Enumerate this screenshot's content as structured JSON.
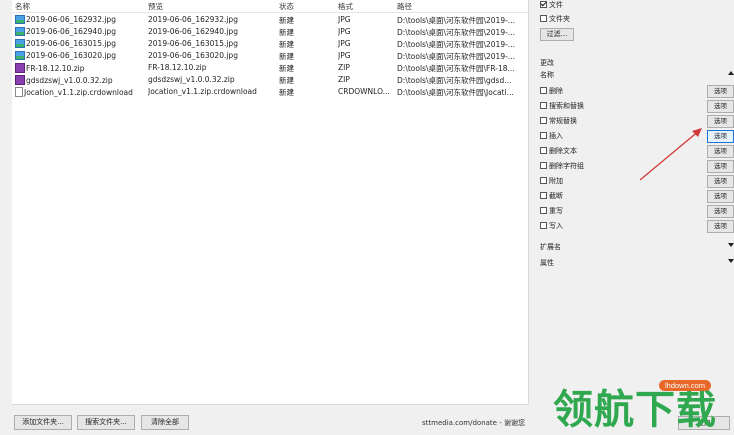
{
  "columns": [
    "名称",
    "预览",
    "状态",
    "格式",
    "路径"
  ],
  "rows": [
    {
      "name": "2019-06-06_162932.jpg",
      "preview": "2019-06-06_162932.jpg",
      "status": "新建",
      "format": "JPG",
      "path": "D:\\tools\\桌面\\河东软件园\\2019-...",
      "icon": "image-file-icon"
    },
    {
      "name": "2019-06-06_162940.jpg",
      "preview": "2019-06-06_162940.jpg",
      "status": "新建",
      "format": "JPG",
      "path": "D:\\tools\\桌面\\河东软件园\\2019-...",
      "icon": "image-file-icon"
    },
    {
      "name": "2019-06-06_163015.jpg",
      "preview": "2019-06-06_163015.jpg",
      "status": "新建",
      "format": "JPG",
      "path": "D:\\tools\\桌面\\河东软件园\\2019-...",
      "icon": "image-file-icon"
    },
    {
      "name": "2019-06-06_163020.jpg",
      "preview": "2019-06-06_163020.jpg",
      "status": "新建",
      "format": "JPG",
      "path": "D:\\tools\\桌面\\河东软件园\\2019-...",
      "icon": "image-file-icon"
    },
    {
      "name": "FR-18.12.10.zip",
      "preview": "FR-18.12.10.zip",
      "status": "新建",
      "format": "ZIP",
      "path": "D:\\tools\\桌面\\河东软件园\\FR-18...",
      "icon": "zip-file-icon"
    },
    {
      "name": "gdsdzswj_v1.0.0.32.zip",
      "preview": "gdsdzswj_v1.0.0.32.zip",
      "status": "新建",
      "format": "ZIP",
      "path": "D:\\tools\\桌面\\河东软件园\\gdsd...",
      "icon": "zip-file-icon"
    },
    {
      "name": "Jocation_v1.1.zip.crdownload",
      "preview": "Jocation_v1.1.zip.crdownload",
      "status": "新建",
      "format": "CRDOWNLO...",
      "path": "D:\\tools\\桌面\\河东软件园\\Jocati...",
      "icon": "download-file-icon"
    }
  ],
  "bottom": {
    "add_folder": "添加文件夹...",
    "search_folder": "搜索文件夹...",
    "clear_all": "清除全部",
    "status": "sttmedia.com/donate - 谢谢您"
  },
  "filter": {
    "file_label": "文件",
    "folder_label": "文件夹",
    "filter_button": "过滤..."
  },
  "changes": {
    "section": "更改",
    "name_label": "名称",
    "option_button": "选项",
    "items": [
      "删除",
      "搜索和替换",
      "常规替换",
      "插入",
      "删除文本",
      "删除字符组",
      "附加",
      "截断",
      "重写",
      "写入"
    ]
  },
  "extension_label": "扩展名",
  "attributes_label": "属性",
  "bottom_right_button": "应用",
  "watermark": {
    "text": "领航下载",
    "badge": "lhdown.com"
  }
}
